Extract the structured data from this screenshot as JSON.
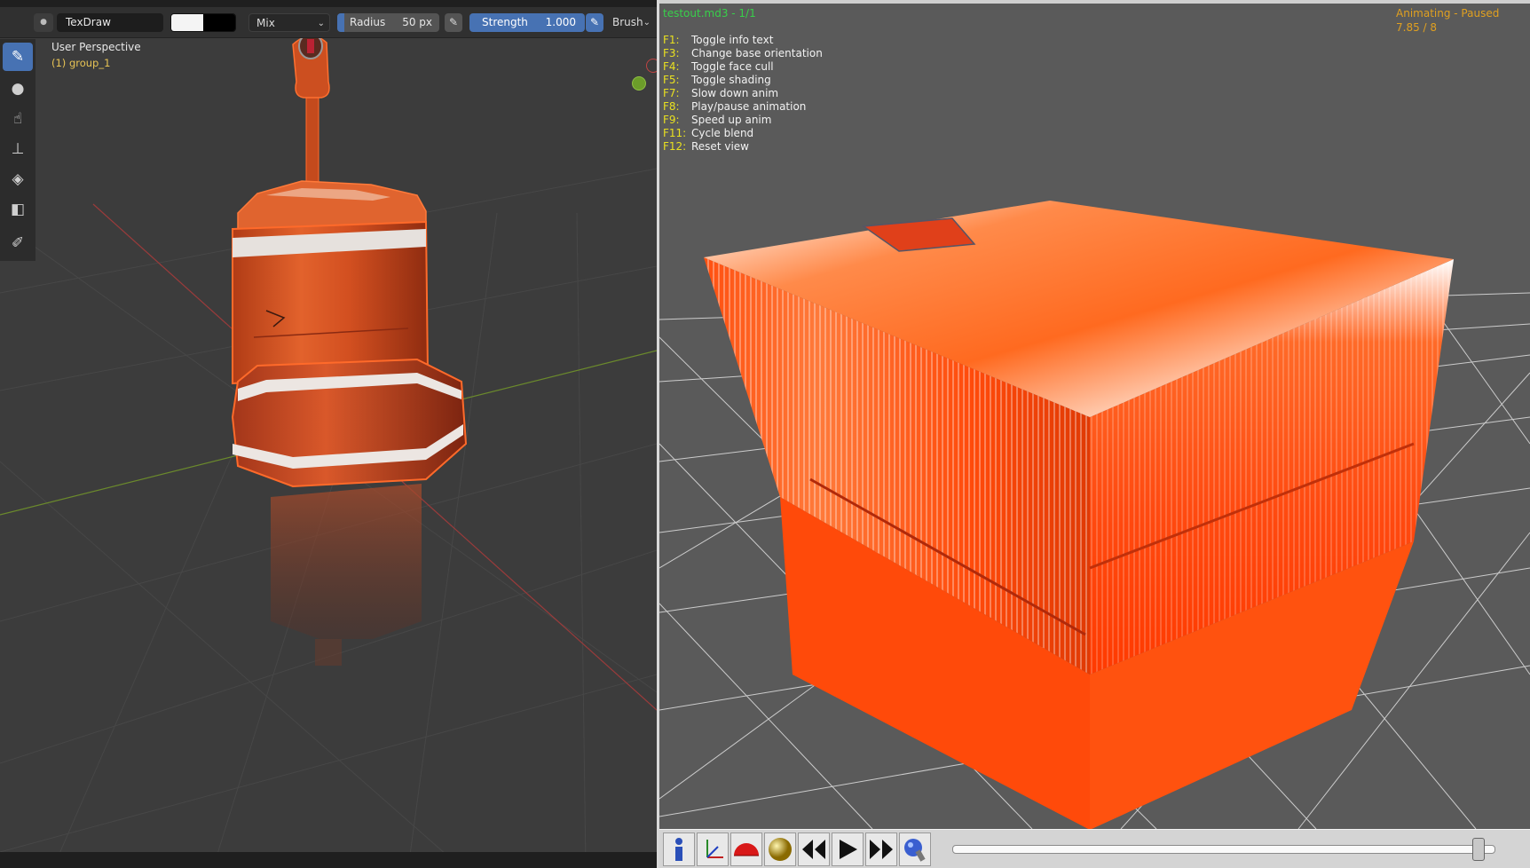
{
  "left": {
    "header": {
      "brush_name": "TexDraw",
      "blend_mode": "Mix",
      "radius_label": "Radius",
      "radius_value": "50 px",
      "strength_label": "Strength",
      "strength_value": "1.000",
      "brush_menu": "Brush"
    },
    "viewport": {
      "view_name": "User Perspective",
      "object_name": "(1) group_1"
    },
    "toolbar": {
      "tools": [
        {
          "name": "draw",
          "active": true
        },
        {
          "name": "soften",
          "active": false
        },
        {
          "name": "smear",
          "active": false
        },
        {
          "name": "clone",
          "active": false
        },
        {
          "name": "fill",
          "active": false
        },
        {
          "name": "mask",
          "active": false
        },
        {
          "name": "annotate",
          "active": false
        }
      ]
    }
  },
  "right": {
    "model_title": "testout.md3 - 1/1",
    "anim_status": "Animating - Paused",
    "anim_frame": "7.85 / 8",
    "key_help": [
      {
        "key": "F1:",
        "desc": "Toggle info text"
      },
      {
        "key": "F3:",
        "desc": "Change base orientation"
      },
      {
        "key": "F4:",
        "desc": "Toggle face cull"
      },
      {
        "key": "F5:",
        "desc": "Toggle shading"
      },
      {
        "key": "F7:",
        "desc": "Slow down anim"
      },
      {
        "key": "F8:",
        "desc": "Play/pause animation"
      },
      {
        "key": "F9:",
        "desc": "Speed up anim"
      },
      {
        "key": "F11:",
        "desc": "Cycle blend"
      },
      {
        "key": "F12:",
        "desc": "Reset view"
      }
    ],
    "timeline": {
      "position": 0.98
    }
  },
  "colors": {
    "blender_accent": "#4772b3",
    "viewer_bg": "#5a5a5a",
    "buoy_orange": "#e05a28",
    "box_orange": "#ff5a14",
    "help_key": "#e8e020",
    "status_orange": "#e0a020",
    "title_green": "#38d04a"
  }
}
